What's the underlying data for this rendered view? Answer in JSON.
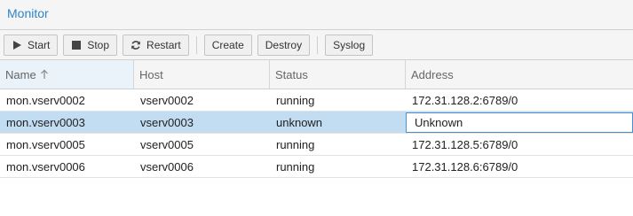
{
  "panel": {
    "title": "Monitor"
  },
  "toolbar": {
    "start": {
      "label": "Start",
      "icon": "play-icon"
    },
    "stop": {
      "label": "Stop",
      "icon": "stop-icon"
    },
    "restart": {
      "label": "Restart",
      "icon": "refresh-icon"
    },
    "create": {
      "label": "Create"
    },
    "destroy": {
      "label": "Destroy"
    },
    "syslog": {
      "label": "Syslog"
    }
  },
  "grid": {
    "columns": [
      "Name",
      "Host",
      "Status",
      "Address"
    ],
    "sort": {
      "column": "Name",
      "direction": "ascending"
    },
    "rows": [
      {
        "name": "mon.vserv0002",
        "host": "vserv0002",
        "status": "running",
        "address": "172.31.128.2:6789/0"
      },
      {
        "name": "mon.vserv0003",
        "host": "vserv0003",
        "status": "unknown",
        "address": "Unknown"
      },
      {
        "name": "mon.vserv0005",
        "host": "vserv0005",
        "status": "running",
        "address": "172.31.128.5:6789/0"
      },
      {
        "name": "mon.vserv0006",
        "host": "vserv0006",
        "status": "running",
        "address": "172.31.128.6:6789/0"
      }
    ],
    "selected_row": 1
  },
  "colors": {
    "accent": "#2d85ca",
    "selected_row": "#c2dcf1",
    "focus_border": "#4a90d0"
  }
}
